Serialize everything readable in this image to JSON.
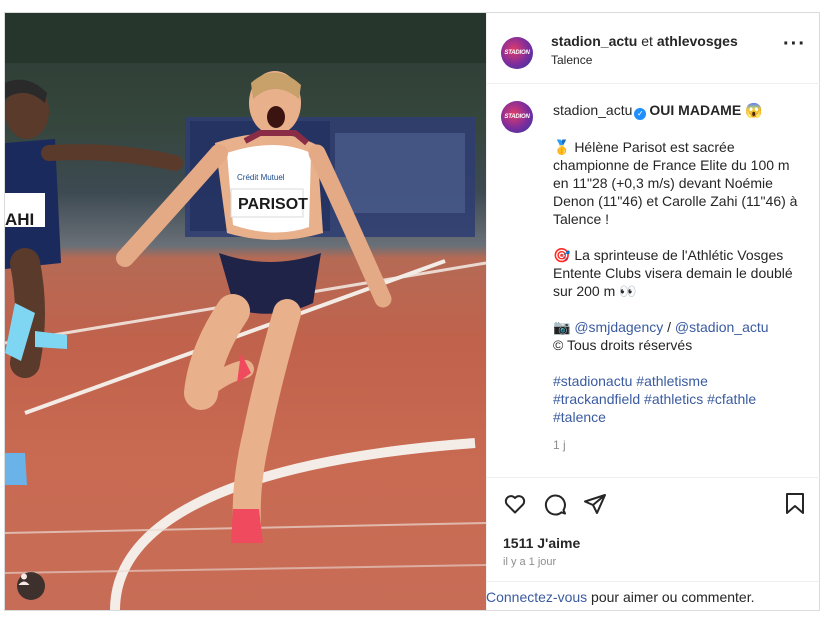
{
  "header": {
    "account": "stadion_actu",
    "joiner": "et",
    "coauthor": "athlevosges",
    "location": "Talence",
    "more_icon": "more-horizontal-icon",
    "logo_text": "STADION"
  },
  "photo": {
    "bib_name": "PARISOT",
    "bib_sponsor": "Crédit Mutuel",
    "left_bib": "AHI"
  },
  "caption": {
    "username": "stadion_actu",
    "headline": "OUI MADAME",
    "line1": "🥇 Hélène Parisot est sacrée championne de France Elite du 100 m en 11\"28 (+0,3 m/s) devant Noémie Denon (11\"46) et Carolle Zahi (11\"46) à Talence !",
    "line2": "🎯 La sprinteuse de l'Athlétic Vosges Entente Clubs visera demain le doublé sur 200 m 👀",
    "credit_camera": "📷",
    "credit1": "@smjdagency",
    "credit_sep": "/",
    "credit2": "@stadion_actu",
    "rights": "© Tous droits réservés",
    "hashtags_1": "#stadionactu #athletisme",
    "hashtags_2": "#trackandfield #athletics #cfathle",
    "hashtags_3": "#talence",
    "age": "1 j"
  },
  "actions": {
    "likes": "1511 J'aime",
    "posted": "il y a 1 jour"
  },
  "login_bar": {
    "link": "Connectez-vous",
    "rest": " pour aimer ou commenter."
  }
}
